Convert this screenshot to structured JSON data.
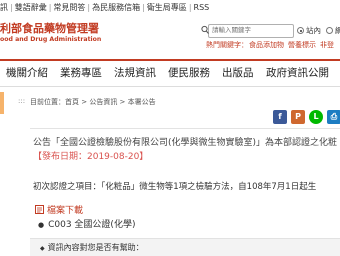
{
  "top_links": [
    "訊",
    "雙語辭彙",
    "常見問答",
    "為民服務信箱",
    "衛生局專區",
    "RSS"
  ],
  "logo": {
    "zh": "利部食品藥物管理署",
    "en": "ood and Drug Administration"
  },
  "search": {
    "placeholder": "請輸入關鍵字",
    "scope_site": "站內",
    "scope_web": "網"
  },
  "hot_words": {
    "label": "熱門關鍵字：",
    "items": [
      "食品添加物",
      "營養標示",
      "非登"
    ]
  },
  "nav": [
    "機關介紹",
    "業務專區",
    "法規資訊",
    "便民服務",
    "出版品",
    "政府資訊公開"
  ],
  "breadcrumb": {
    "text": "目前位置：首頁 > 公告資訊 > 本署公告"
  },
  "share": [
    {
      "icon": "facebook-icon",
      "label": "f",
      "color": "#3b5998"
    },
    {
      "icon": "plurk-icon",
      "label": "P",
      "color": "#cf682f"
    },
    {
      "icon": "line-icon",
      "label": "L",
      "color": "#00b900"
    },
    {
      "icon": "print-icon",
      "label": "⎙",
      "color": "#1d7dc2"
    }
  ],
  "announcement": {
    "title": "公告「全國公證檢驗股份有限公司(化學與微生物實驗室)」為本部認證之化粧",
    "date": "【發布日期：2019-08-20】",
    "description": "初次認證之項目：「化粧品」微生物等1項之檢驗方法，自108年7月1日起生"
  },
  "download": {
    "label": "檔案下載",
    "items": [
      "C003 全國公證(化學)"
    ]
  },
  "feedback": {
    "label": "資訊內容對您是否有幫助："
  },
  "colors": {
    "brand": "#c23b22",
    "date": "#d9534f",
    "accent": "#f6b36b"
  }
}
